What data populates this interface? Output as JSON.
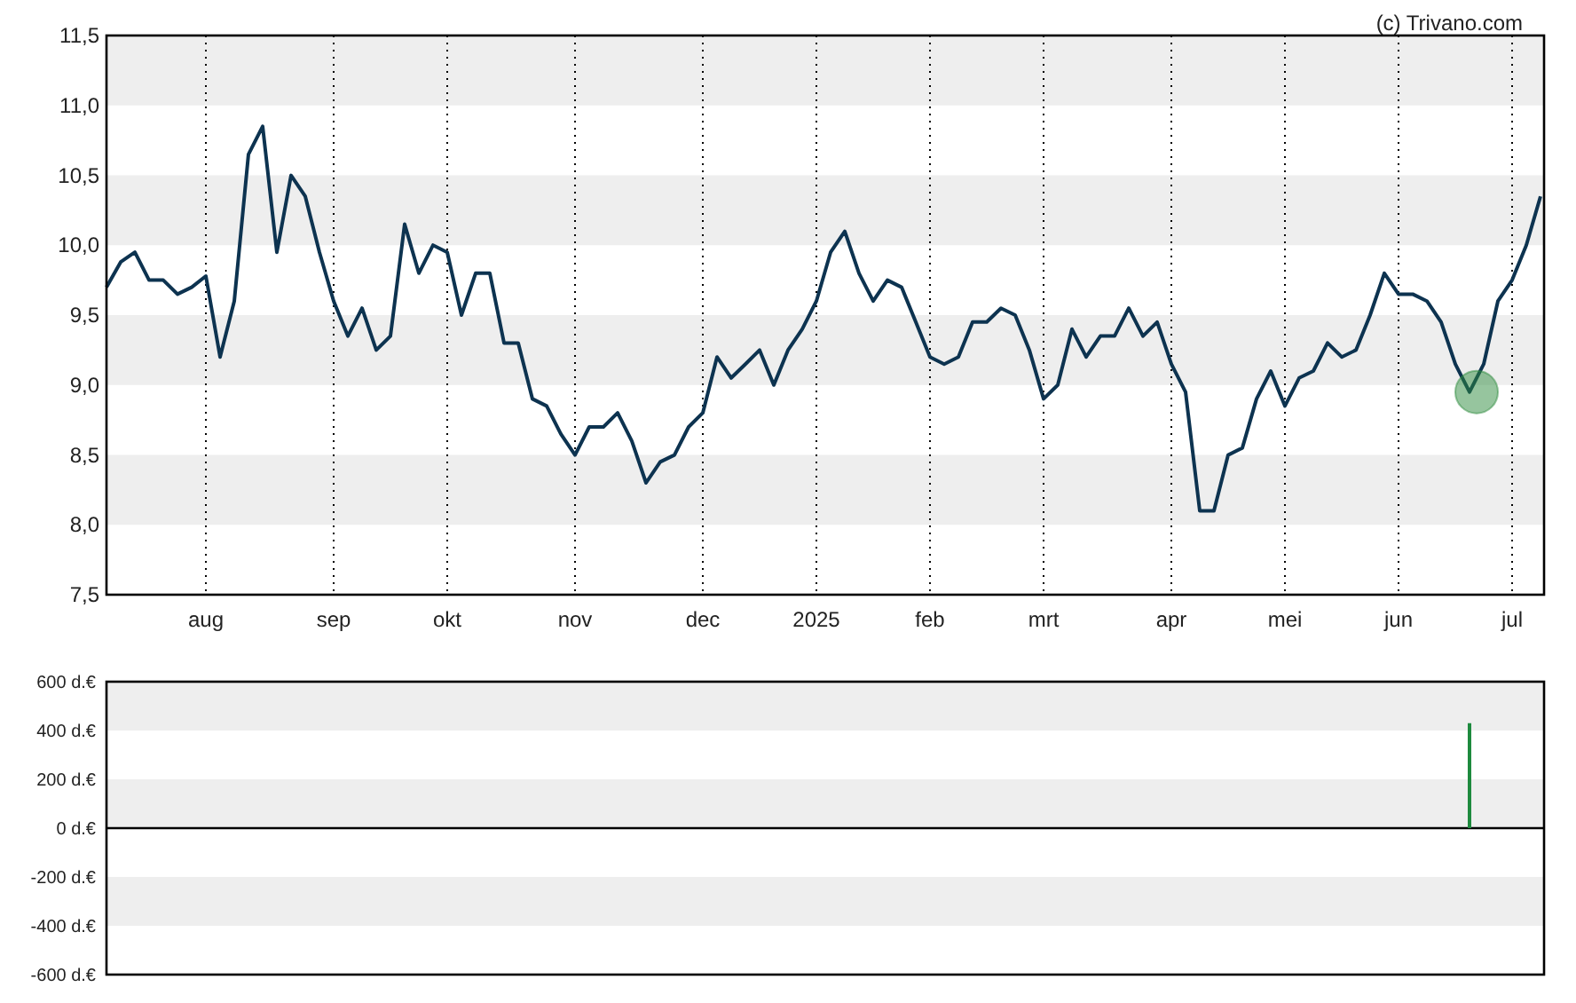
{
  "credit": "(c) Trivano.com",
  "price_chart": {
    "chart_data": {
      "type": "line",
      "categories": [
        null,
        null,
        null,
        null,
        null,
        null,
        null,
        "aug",
        null,
        null,
        null,
        null,
        null,
        null,
        null,
        null,
        "sep",
        null,
        null,
        null,
        null,
        null,
        null,
        null,
        "okt",
        null,
        null,
        null,
        null,
        null,
        null,
        null,
        null,
        "nov",
        null,
        null,
        null,
        null,
        null,
        null,
        null,
        null,
        "dec",
        null,
        null,
        null,
        null,
        null,
        null,
        null,
        "2025",
        null,
        null,
        null,
        null,
        null,
        null,
        null,
        "feb",
        null,
        null,
        null,
        null,
        null,
        null,
        null,
        "mrt",
        null,
        null,
        null,
        null,
        null,
        null,
        null,
        null,
        "apr",
        null,
        null,
        null,
        null,
        null,
        null,
        null,
        "mei",
        null,
        null,
        null,
        null,
        null,
        null,
        null,
        "jun",
        null,
        null,
        null,
        null,
        null,
        null,
        null,
        "jul",
        null,
        null
      ],
      "series": [
        {
          "color": "#0d3350",
          "values": [
            9.7,
            9.88,
            9.95,
            9.75,
            9.75,
            9.65,
            9.7,
            9.78,
            9.2,
            9.6,
            10.65,
            10.85,
            9.95,
            10.5,
            10.35,
            9.95,
            9.6,
            9.35,
            9.55,
            9.25,
            9.35,
            10.15,
            9.8,
            10.0,
            9.95,
            9.5,
            9.8,
            9.8,
            9.3,
            9.3,
            8.9,
            8.85,
            8.65,
            8.5,
            8.7,
            8.7,
            8.8,
            8.6,
            8.3,
            8.45,
            8.5,
            8.7,
            8.8,
            9.2,
            9.05,
            9.15,
            9.25,
            9.0,
            9.25,
            9.4,
            9.6,
            9.95,
            10.1,
            9.8,
            9.6,
            9.75,
            9.7,
            9.45,
            9.2,
            9.15,
            9.2,
            9.45,
            9.45,
            9.55,
            9.5,
            9.25,
            8.9,
            9.0,
            9.4,
            9.2,
            9.35,
            9.35,
            9.55,
            9.35,
            9.45,
            9.15,
            8.95,
            8.1,
            8.1,
            8.5,
            8.55,
            8.9,
            9.1,
            8.85,
            9.05,
            9.1,
            9.3,
            9.2,
            9.25,
            9.5,
            9.8,
            9.65,
            9.65,
            9.6,
            9.45,
            9.15,
            8.95,
            9.15,
            9.6,
            9.75,
            10.0,
            10.35
          ]
        }
      ],
      "ylim": [
        7.5,
        11.5
      ],
      "yticks": [
        {
          "value": 7.5,
          "label": "7,5"
        },
        {
          "value": 8,
          "label": "8,0"
        },
        {
          "value": 8.5,
          "label": "8,5"
        },
        {
          "value": 9,
          "label": "9,0"
        },
        {
          "value": 9.5,
          "label": "9,5"
        },
        {
          "value": 10,
          "label": "10,0"
        },
        {
          "value": 10.5,
          "label": "10,5"
        },
        {
          "value": 11,
          "label": "11,0"
        },
        {
          "value": 11.5,
          "label": "11,5"
        }
      ],
      "grid": true
    }
  },
  "volume_chart": {
    "chart_data": {
      "type": "bar",
      "categories": [
        null,
        null,
        null,
        null,
        null,
        null,
        null,
        null,
        null,
        null,
        null,
        null,
        null,
        null,
        null,
        null,
        null,
        null,
        null,
        null,
        null,
        null,
        null,
        null,
        null,
        null,
        null,
        null,
        null,
        null,
        null,
        null,
        null,
        null,
        null,
        null,
        null,
        null,
        null,
        null,
        null,
        null,
        null,
        null,
        null,
        null,
        null,
        null,
        null,
        null,
        null,
        null,
        null,
        null,
        null,
        null,
        null,
        null,
        null,
        null,
        null,
        null,
        null,
        null,
        null,
        null,
        null,
        null,
        null,
        null,
        null,
        null,
        null,
        null,
        null,
        null,
        null,
        null,
        null,
        null,
        null,
        null,
        null,
        null,
        null,
        null,
        null,
        null,
        null,
        null,
        null,
        null,
        null,
        null,
        null,
        null,
        null,
        null,
        null,
        null,
        null,
        null
      ],
      "series": [
        {
          "color": "#1e8a3e",
          "values": [
            null,
            null,
            null,
            null,
            null,
            null,
            null,
            null,
            null,
            null,
            null,
            null,
            null,
            null,
            null,
            null,
            null,
            null,
            null,
            null,
            null,
            null,
            null,
            null,
            null,
            null,
            null,
            null,
            null,
            null,
            null,
            null,
            null,
            null,
            null,
            null,
            null,
            null,
            null,
            null,
            null,
            null,
            null,
            null,
            null,
            null,
            null,
            null,
            null,
            null,
            null,
            null,
            null,
            null,
            null,
            null,
            null,
            null,
            null,
            null,
            null,
            null,
            null,
            null,
            null,
            null,
            null,
            null,
            null,
            null,
            null,
            null,
            null,
            null,
            null,
            null,
            null,
            null,
            null,
            null,
            null,
            null,
            null,
            null,
            null,
            null,
            null,
            null,
            null,
            null,
            null,
            null,
            null,
            null,
            null,
            null,
            430,
            null,
            null,
            null,
            null,
            null
          ]
        }
      ],
      "ylim": [
        -600,
        600
      ],
      "grid": true,
      "yticks": [
        {
          "value": -600,
          "label": "-600 d.€"
        },
        {
          "value": -400,
          "label": "-400 d.€"
        },
        {
          "value": -200,
          "label": "-200 d.€"
        },
        {
          "value": 0,
          "label": "0 d.€"
        },
        {
          "value": 200,
          "label": "200 d.€"
        },
        {
          "value": 400,
          "label": "400 d.€"
        },
        {
          "value": 600,
          "label": "600 d.€"
        }
      ]
    }
  }
}
